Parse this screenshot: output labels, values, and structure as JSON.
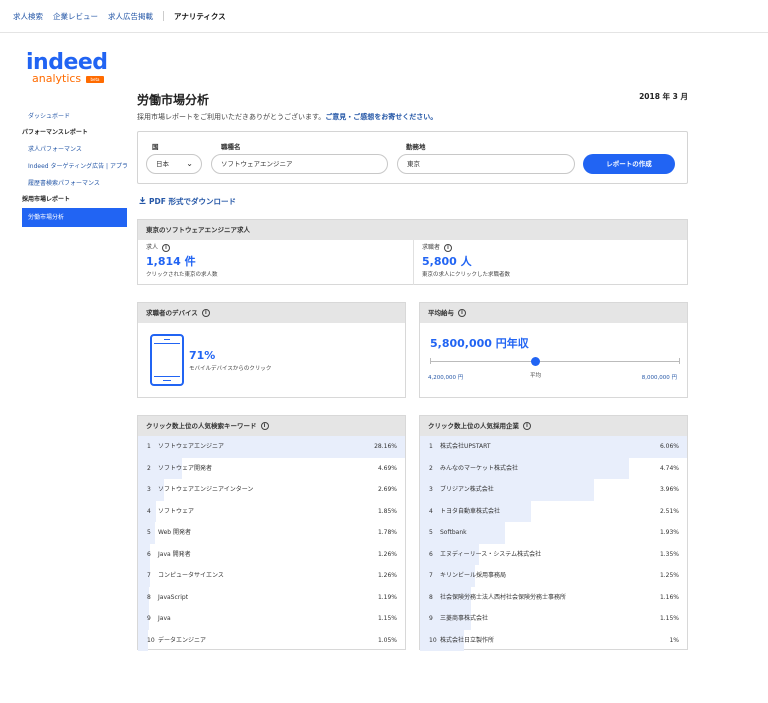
{
  "topnav": {
    "items": [
      "求人検索",
      "企業レビュー",
      "求人広告掲載"
    ],
    "active": "アナリティクス"
  },
  "logo": {
    "brand": "indeed",
    "product": "analytics",
    "badge": "beta"
  },
  "sidebar": {
    "dashboard": "ダッシュボード",
    "perf_heading": "パフォーマンスレポート",
    "perf_items": [
      "求人パフォーマンス",
      "Indeed ターゲティング広告 | アプライ",
      "履歴書検索パフォーマンス"
    ],
    "hiring_heading": "採用市場レポート",
    "hiring_active": "労働市場分析"
  },
  "header": {
    "title": "労働市場分析",
    "date": "2018 年 3 月",
    "subtitle_text": "採用市場レポートをご利用いただきありがとうございます。",
    "subtitle_link": "ご意見・ご感想をお寄せください。"
  },
  "filters": {
    "country_label": "国",
    "country_value": "日本",
    "job_label": "職種名",
    "job_value": "ソフトウェアエンジニア",
    "location_label": "勤務地",
    "location_value": "東京",
    "submit": "レポートの作成"
  },
  "pdf_link": "PDF 形式でダウンロード",
  "summary": {
    "title": "東京のソフトウェアエンジニア求人",
    "jobs": {
      "label": "求人",
      "value": "1,814 件",
      "desc": "クリックされた東京の求人数"
    },
    "seekers": {
      "label": "求職者",
      "value": "5,800 人",
      "desc": "東京の求人にクリックした求職者数"
    }
  },
  "devices": {
    "title": "求職者のデバイス",
    "value": "71%",
    "desc": "モバイルデバイスからのクリック"
  },
  "salary": {
    "title": "平均給与",
    "value": "5,800,000 円年収",
    "min": "4,200,000 円",
    "avg_label": "平均",
    "max": "8,000,000 円",
    "position_fraction": 0.42
  },
  "keywords": {
    "title": "クリック数上位の人気検索キーワード",
    "rows": [
      {
        "rank": "1",
        "name": "ソフトウェアエンジニア",
        "pct": "28.16%",
        "value": 28.16
      },
      {
        "rank": "2",
        "name": "ソフトウェア開発者",
        "pct": "4.69%",
        "value": 4.69
      },
      {
        "rank": "3",
        "name": "ソフトウェアエンジニアインターン",
        "pct": "2.69%",
        "value": 2.69
      },
      {
        "rank": "4",
        "name": "ソフトウェア",
        "pct": "1.85%",
        "value": 1.85
      },
      {
        "rank": "5",
        "name": "Web 開発者",
        "pct": "1.78%",
        "value": 1.78
      },
      {
        "rank": "6",
        "name": "Java 開発者",
        "pct": "1.26%",
        "value": 1.26
      },
      {
        "rank": "7",
        "name": "コンピュータサイエンス",
        "pct": "1.26%",
        "value": 1.26
      },
      {
        "rank": "8",
        "name": "JavaScript",
        "pct": "1.19%",
        "value": 1.19
      },
      {
        "rank": "9",
        "name": "Java",
        "pct": "1.15%",
        "value": 1.15
      },
      {
        "rank": "10",
        "name": "データエンジニア",
        "pct": "1.05%",
        "value": 1.05
      }
    ]
  },
  "companies": {
    "title": "クリック数上位の人気採用企業",
    "rows": [
      {
        "rank": "1",
        "name": "株式会社UPSTART",
        "pct": "6.06%",
        "value": 6.06
      },
      {
        "rank": "2",
        "name": "みんなのマーケット株式会社",
        "pct": "4.74%",
        "value": 4.74
      },
      {
        "rank": "3",
        "name": "ブリジアン株式会社",
        "pct": "3.96%",
        "value": 3.96
      },
      {
        "rank": "4",
        "name": "トヨタ自動車株式会社",
        "pct": "2.51%",
        "value": 2.51
      },
      {
        "rank": "5",
        "name": "Softbank",
        "pct": "1.93%",
        "value": 1.93
      },
      {
        "rank": "6",
        "name": "エヌディーリース・システム株式会社",
        "pct": "1.35%",
        "value": 1.35
      },
      {
        "rank": "7",
        "name": "キリンビール採用事務局",
        "pct": "1.25%",
        "value": 1.25
      },
      {
        "rank": "8",
        "name": "社会保険労務士法人西村社会保険労務士事務所",
        "pct": "1.16%",
        "value": 1.16
      },
      {
        "rank": "9",
        "name": "三菱商事株式会社",
        "pct": "1.15%",
        "value": 1.15
      },
      {
        "rank": "10",
        "name": "株式会社日立製作所",
        "pct": "1%",
        "value": 1
      }
    ]
  },
  "colors": {
    "brand_blue": "#2164f3",
    "link_blue": "#2557a7",
    "brand_orange": "#ff6b00",
    "bar_fill": "#e8eefb"
  }
}
